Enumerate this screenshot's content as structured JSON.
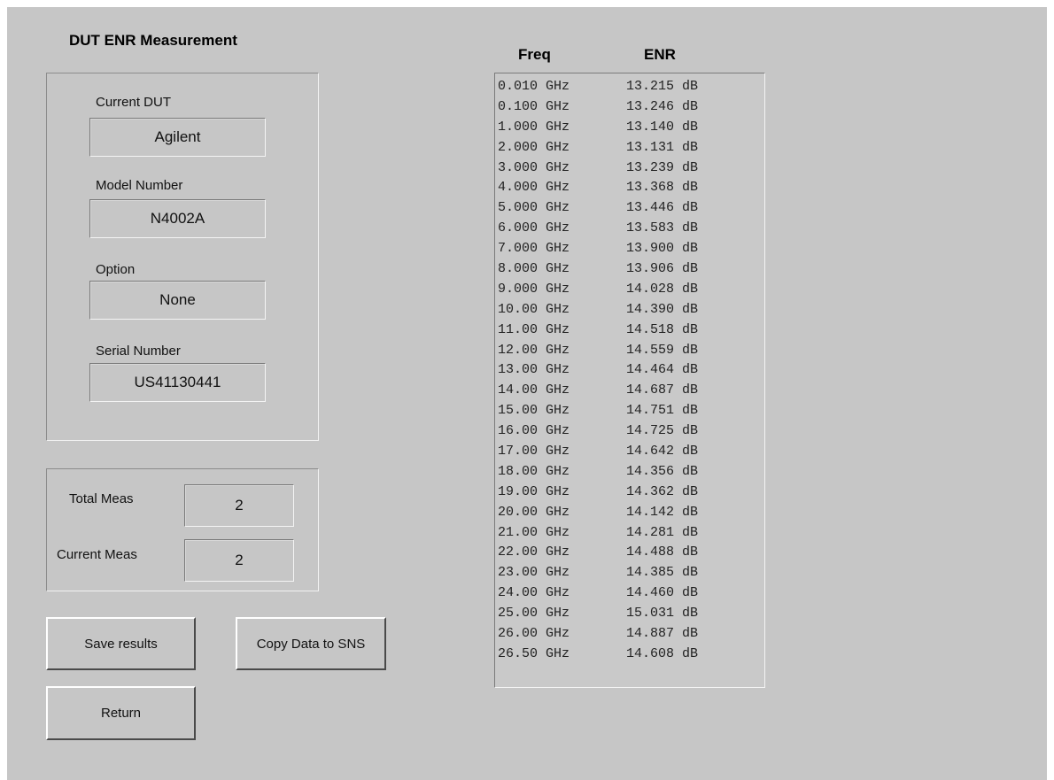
{
  "title": "DUT ENR Measurement",
  "dut": {
    "current_dut_label": "Current DUT",
    "current_dut_value": "Agilent",
    "model_label": "Model Number",
    "model_value": "N4002A",
    "option_label": "Option",
    "option_value": "None",
    "serial_label": "Serial Number",
    "serial_value": "US41130441"
  },
  "meas": {
    "total_label": "Total Meas",
    "total_value": "2",
    "current_label": "Current Meas",
    "current_value": "2"
  },
  "buttons": {
    "save": "Save results",
    "copy": "Copy Data to SNS",
    "return": "Return"
  },
  "table": {
    "freq_header": "Freq",
    "enr_header": "ENR",
    "rows": [
      {
        "freq": "0.010 GHz",
        "enr": "13.215 dB"
      },
      {
        "freq": "0.100 GHz",
        "enr": "13.246 dB"
      },
      {
        "freq": "1.000 GHz",
        "enr": "13.140 dB"
      },
      {
        "freq": "2.000 GHz",
        "enr": "13.131 dB"
      },
      {
        "freq": "3.000 GHz",
        "enr": "13.239 dB"
      },
      {
        "freq": "4.000 GHz",
        "enr": "13.368 dB"
      },
      {
        "freq": "5.000 GHz",
        "enr": "13.446 dB"
      },
      {
        "freq": "6.000 GHz",
        "enr": "13.583 dB"
      },
      {
        "freq": "7.000 GHz",
        "enr": "13.900 dB"
      },
      {
        "freq": "8.000 GHz",
        "enr": "13.906 dB"
      },
      {
        "freq": "9.000 GHz",
        "enr": "14.028 dB"
      },
      {
        "freq": "10.00 GHz",
        "enr": "14.390 dB"
      },
      {
        "freq": "11.00 GHz",
        "enr": "14.518 dB"
      },
      {
        "freq": "12.00 GHz",
        "enr": "14.559 dB"
      },
      {
        "freq": "13.00 GHz",
        "enr": "14.464 dB"
      },
      {
        "freq": "14.00 GHz",
        "enr": "14.687 dB"
      },
      {
        "freq": "15.00 GHz",
        "enr": "14.751 dB"
      },
      {
        "freq": "16.00 GHz",
        "enr": "14.725 dB"
      },
      {
        "freq": "17.00 GHz",
        "enr": "14.642 dB"
      },
      {
        "freq": "18.00 GHz",
        "enr": "14.356 dB"
      },
      {
        "freq": "19.00 GHz",
        "enr": "14.362 dB"
      },
      {
        "freq": "20.00 GHz",
        "enr": "14.142 dB"
      },
      {
        "freq": "21.00 GHz",
        "enr": "14.281 dB"
      },
      {
        "freq": "22.00 GHz",
        "enr": "14.488 dB"
      },
      {
        "freq": "23.00 GHz",
        "enr": "14.385 dB"
      },
      {
        "freq": "24.00 GHz",
        "enr": "14.460 dB"
      },
      {
        "freq": "25.00 GHz",
        "enr": "15.031 dB"
      },
      {
        "freq": "26.00 GHz",
        "enr": "14.887 dB"
      },
      {
        "freq": "26.50 GHz",
        "enr": "14.608 dB"
      }
    ]
  }
}
